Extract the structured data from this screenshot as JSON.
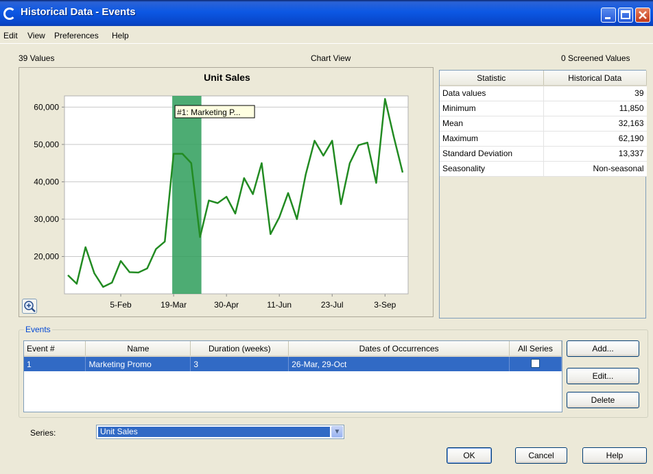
{
  "window": {
    "title": "Historical Data - Events"
  },
  "menu": [
    "Edit",
    "View",
    "Preferences",
    "Help"
  ],
  "header": {
    "values_count": "39 Values",
    "view_label": "Chart View",
    "screened": "0 Screened Values"
  },
  "chart_data": {
    "type": "line",
    "title": "Unit Sales",
    "x_ticks": [
      "5-Feb",
      "19-Mar",
      "30-Apr",
      "11-Jun",
      "23-Jul",
      "3-Sep"
    ],
    "y_ticks": [
      "20,000",
      "30,000",
      "40,000",
      "50,000",
      "60,000"
    ],
    "ylim": [
      10000,
      63000
    ],
    "series": [
      {
        "color": "#228b22",
        "values": [
          15000,
          12700,
          22500,
          15500,
          11850,
          13000,
          18800,
          15800,
          15700,
          16800,
          22000,
          24000,
          47500,
          47500,
          45000,
          25200,
          35000,
          34300,
          36000,
          31500,
          41000,
          36700,
          45000,
          26000,
          30500,
          37000,
          30000,
          42000,
          51000,
          47000,
          51000,
          34000,
          45000,
          49800,
          50500,
          39700,
          62190,
          52000,
          42500
        ]
      }
    ],
    "event_band": {
      "start_index": 12,
      "end_index": 15,
      "label": "#1: Marketing P...",
      "color": "#2e9e5b"
    },
    "grid": true
  },
  "stats": {
    "headers": [
      "Statistic",
      "Historical Data"
    ],
    "rows": [
      {
        "name": "Data values",
        "value": "39"
      },
      {
        "name": "Minimum",
        "value": "11,850"
      },
      {
        "name": "Mean",
        "value": "32,163"
      },
      {
        "name": "Maximum",
        "value": "62,190"
      },
      {
        "name": "Standard Deviation",
        "value": "13,337"
      },
      {
        "name": "Seasonality",
        "value": "Non-seasonal"
      }
    ]
  },
  "events": {
    "legend": "Events",
    "headers": [
      "Event #",
      "Name",
      "Duration (weeks)",
      "Dates of Occurrences",
      "All Series"
    ],
    "rows": [
      {
        "num": "1",
        "name": "Marketing Promo",
        "duration": "3",
        "dates": "26-Mar, 29-Oct",
        "all_series": false
      }
    ],
    "buttons": {
      "add": "Add...",
      "edit": "Edit...",
      "delete": "Delete"
    }
  },
  "series_select": {
    "label": "Series:",
    "value": "Unit Sales"
  },
  "footer": {
    "ok": "OK",
    "cancel": "Cancel",
    "help": "Help"
  }
}
